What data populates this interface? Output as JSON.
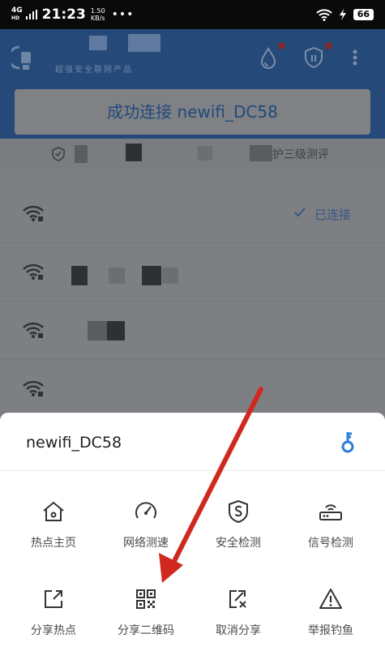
{
  "status_bar": {
    "network": "4G",
    "network_sup": "HD",
    "time": "21:23",
    "speed_value": "1.50",
    "speed_unit": "KB/s",
    "dots": "•••",
    "battery": "66"
  },
  "header": {
    "subtitle": "超强安全联网产品",
    "connected_title": "成功连接 newifi_DC58",
    "security_tail": "护三级测评"
  },
  "network_list": {
    "connected_label": "已连接"
  },
  "sheet": {
    "ssid": "newifi_DC58",
    "actions": [
      {
        "label": "热点主页",
        "icon": "home-icon"
      },
      {
        "label": "网络测速",
        "icon": "speedometer-icon"
      },
      {
        "label": "安全检测",
        "icon": "shield-icon"
      },
      {
        "label": "信号检测",
        "icon": "router-icon"
      },
      {
        "label": "分享热点",
        "icon": "share-icon"
      },
      {
        "label": "分享二维码",
        "icon": "qr-code-icon"
      },
      {
        "label": "取消分享",
        "icon": "unshare-icon"
      },
      {
        "label": "举报钓鱼",
        "icon": "warning-icon"
      }
    ]
  },
  "colors": {
    "accent_blue": "#2f7dd6",
    "annotation_arrow": "#d0281f",
    "overlay_gray": "#7d7f82"
  }
}
